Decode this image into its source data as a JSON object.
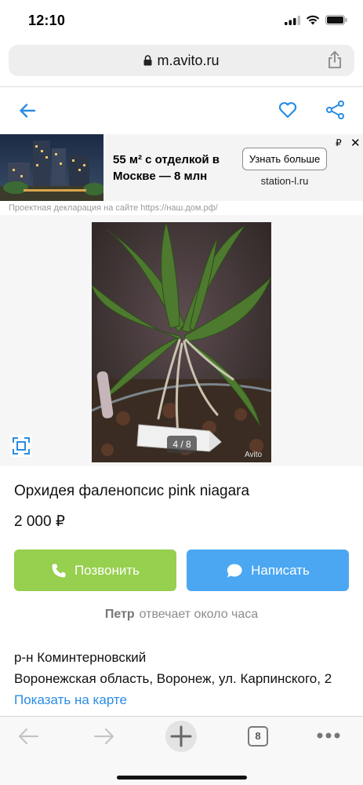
{
  "status": {
    "time": "12:10"
  },
  "browser": {
    "url": "m.avito.ru"
  },
  "ad": {
    "headline": "55 м² с отделкой в Москве — 8 млн",
    "cta": "Узнать больше",
    "domain": "station-l.ru",
    "mark": "₽",
    "close": "✕",
    "disclaimer": "Проектная декларация на сайте https://наш.дом.рф/"
  },
  "gallery": {
    "counter": "4 / 8",
    "watermark": "Avito"
  },
  "listing": {
    "title": "Орхидея фаленопсис pink niagara",
    "price": "2 000 ₽",
    "call_label": "Позвонить",
    "write_label": "Написать",
    "seller_name": "Петр",
    "response_time": "отвечает около часа",
    "district": "р-н Коминтерновский",
    "address": "Воронежская область, Воронеж, ул. Карпинского, 2",
    "map_link": "Показать на карте"
  },
  "toolbar": {
    "tabs_count": "8"
  },
  "colors": {
    "accent_blue": "#2a8ce4",
    "call_green": "#97cf4e",
    "write_blue": "#4ba7f2"
  }
}
